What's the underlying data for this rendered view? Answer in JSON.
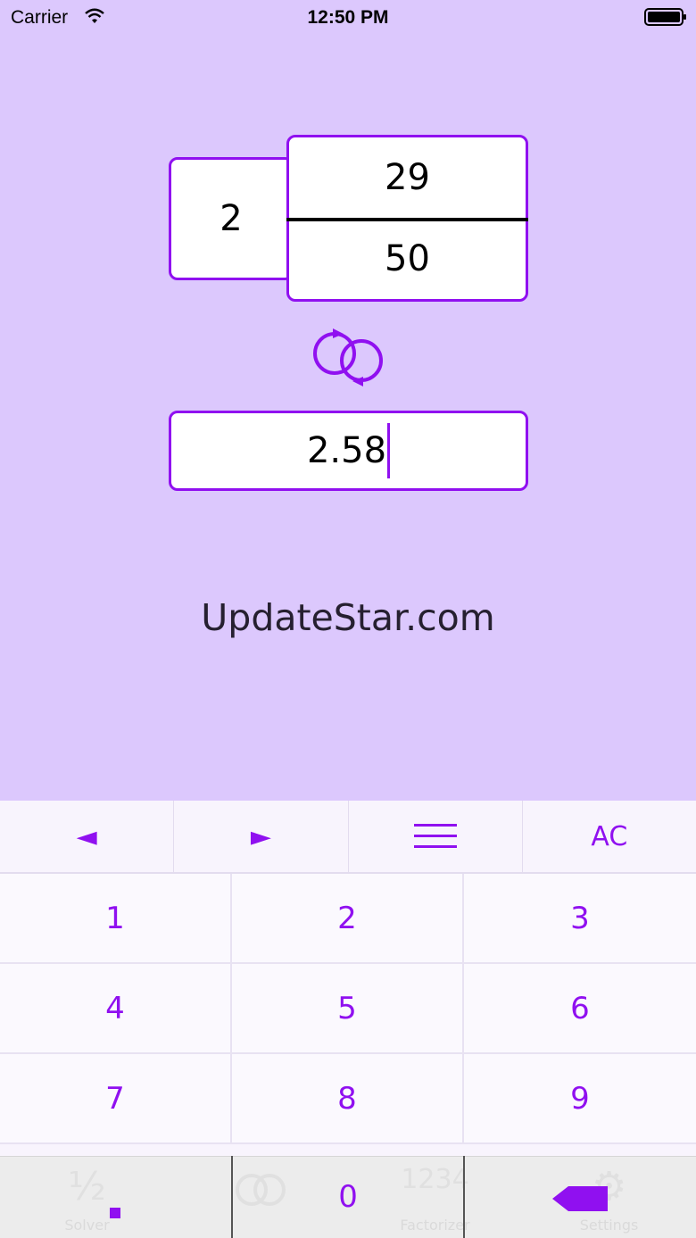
{
  "status": {
    "carrier": "Carrier",
    "time": "12:50 PM"
  },
  "fraction": {
    "whole": "2",
    "numerator": "29",
    "denominator": "50"
  },
  "decimal": {
    "value": "2.58"
  },
  "watermark": "UpdateStar.com",
  "toolbar": {
    "left_arrow": "◄",
    "right_arrow": "►",
    "menu": "☰",
    "clear": "AC"
  },
  "keys": [
    "1",
    "2",
    "3",
    "4",
    "5",
    "6",
    "7",
    "8",
    "9"
  ],
  "bottom_keys": {
    "zero": "0"
  },
  "tabs": [
    {
      "label": "Solver",
      "glyph": "½",
      "icon": "fraction-icon"
    },
    {
      "label": "",
      "glyph": "",
      "icon": "convert-tab-icon"
    },
    {
      "label": "Factorizer",
      "glyph": "1234",
      "icon": "numbers-icon"
    },
    {
      "label": "Settings",
      "glyph": "⚙",
      "icon": "gear-icon"
    }
  ],
  "colors": {
    "accent": "#9010f0",
    "background": "#dcc8fd",
    "keyboard": "#f8f4fd"
  }
}
